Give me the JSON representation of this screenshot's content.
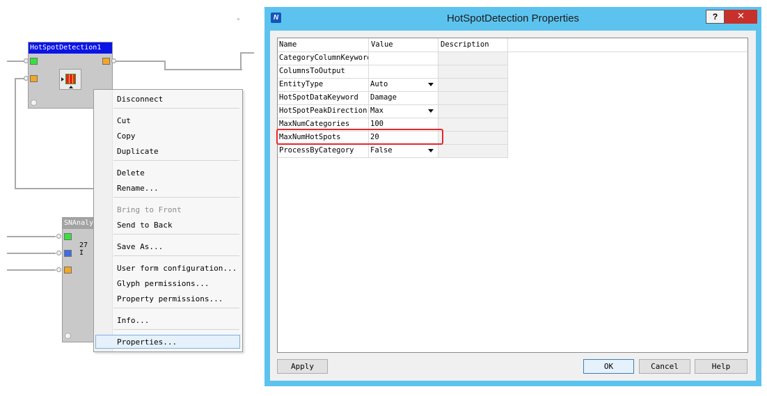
{
  "workspace": {
    "node1_title": "HotSpotDetection1",
    "node2_title": "SNAnaly",
    "node2_text": "27 I"
  },
  "context_menu": {
    "items": [
      {
        "label": "Disconnect"
      },
      {
        "label": "Cut"
      },
      {
        "label": "Copy"
      },
      {
        "label": "Duplicate"
      },
      {
        "label": "Delete"
      },
      {
        "label": "Rename..."
      },
      {
        "label": "Bring to Front",
        "disabled": true
      },
      {
        "label": "Send to Back"
      },
      {
        "label": "Save As..."
      },
      {
        "label": "User form configuration..."
      },
      {
        "label": "Glyph permissions..."
      },
      {
        "label": "Property permissions..."
      },
      {
        "label": "Info..."
      },
      {
        "label": "Properties...",
        "highlighted": true
      }
    ]
  },
  "dialog": {
    "title": "HotSpotDetection Properties",
    "icon_letter": "N",
    "help_label": "?",
    "close_label": "✕",
    "columns": [
      "Name",
      "Value",
      "Description"
    ],
    "rows": [
      {
        "name": "CategoryColumnKeyword",
        "value": ""
      },
      {
        "name": "ColumnsToOutput",
        "value": ""
      },
      {
        "name": "EntityType",
        "value": "Auto",
        "dropdown": true
      },
      {
        "name": "HotSpotDataKeyword",
        "value": "Damage"
      },
      {
        "name": "HotSpotPeakDirection",
        "value": "Max",
        "dropdown": true
      },
      {
        "name": "MaxNumCategories",
        "value": "100"
      },
      {
        "name": "MaxNumHotSpots",
        "value": "20",
        "highlighted": true
      },
      {
        "name": "ProcessByCategory",
        "value": "False",
        "dropdown": true
      }
    ],
    "buttons": {
      "apply": "Apply",
      "ok": "OK",
      "cancel": "Cancel",
      "help": "Help"
    }
  },
  "colors": {
    "title_bar": "#5cc3ef",
    "close_button": "#c7302b",
    "highlight_box": "#e8262a",
    "node_title": "#0a14e6"
  }
}
